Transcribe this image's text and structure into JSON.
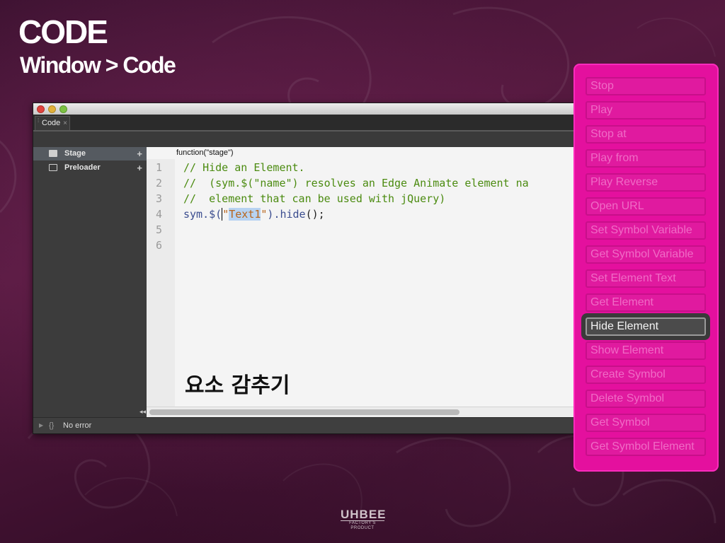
{
  "slide": {
    "title": "CODE",
    "subtitle": "Window > Code"
  },
  "window": {
    "tab_label": "Code",
    "tab_close_icon": "×",
    "sidebar": {
      "items": [
        {
          "label": "Stage",
          "icon": "stage-icon",
          "selected": true
        },
        {
          "label": "Preloader",
          "icon": "preloader-icon",
          "selected": false
        }
      ],
      "add_icon": "+",
      "collapse_icon": "◂◂"
    },
    "editor": {
      "function_header": "function(\"stage\")",
      "line_numbers": [
        "1",
        "2",
        "3",
        "4",
        "5",
        "6"
      ],
      "code_lines": [
        "// Hide an Element.",
        "//  (sym.$(\"name\") resolves an Edge Animate element na",
        "//  element that can be used with jQuery)",
        "sym.$(\"Text1\").hide();"
      ],
      "code_line4_parts": {
        "prefix": "sym.$(",
        "quote_open": "\"",
        "selected_text": "Text1",
        "quote_close": "\"",
        "suffix_paren": ")",
        "method": ".hide",
        "end": "();"
      },
      "annotation": "요소 감추기"
    },
    "status": {
      "arrow": "▶",
      "braces": "{}",
      "text": "No error"
    }
  },
  "actions_panel": {
    "items": [
      {
        "label": "Stop",
        "active": false
      },
      {
        "label": "Play",
        "active": false
      },
      {
        "label": "Stop at",
        "active": false
      },
      {
        "label": "Play from",
        "active": false
      },
      {
        "label": "Play Reverse",
        "active": false
      },
      {
        "label": "Open URL",
        "active": false
      },
      {
        "label": "Set Symbol Variable",
        "active": false
      },
      {
        "label": "Get Symbol Variable",
        "active": false
      },
      {
        "label": "Set Element Text",
        "active": false
      },
      {
        "label": "Get Element",
        "active": false
      },
      {
        "label": "Hide Element",
        "active": true
      },
      {
        "label": "Show Element",
        "active": false
      },
      {
        "label": "Create Symbol",
        "active": false
      },
      {
        "label": "Delete Symbol",
        "active": false
      },
      {
        "label": "Get Symbol",
        "active": false
      },
      {
        "label": "Get Symbol Element",
        "active": false
      }
    ]
  },
  "logo": {
    "main": "UHBEE",
    "sub": "FACTORY'S PRODUCT"
  },
  "colors": {
    "panel": "#e4109e",
    "comment": "#4b8b10",
    "string": "#b8651b",
    "active_action": "#4b4b4b"
  }
}
